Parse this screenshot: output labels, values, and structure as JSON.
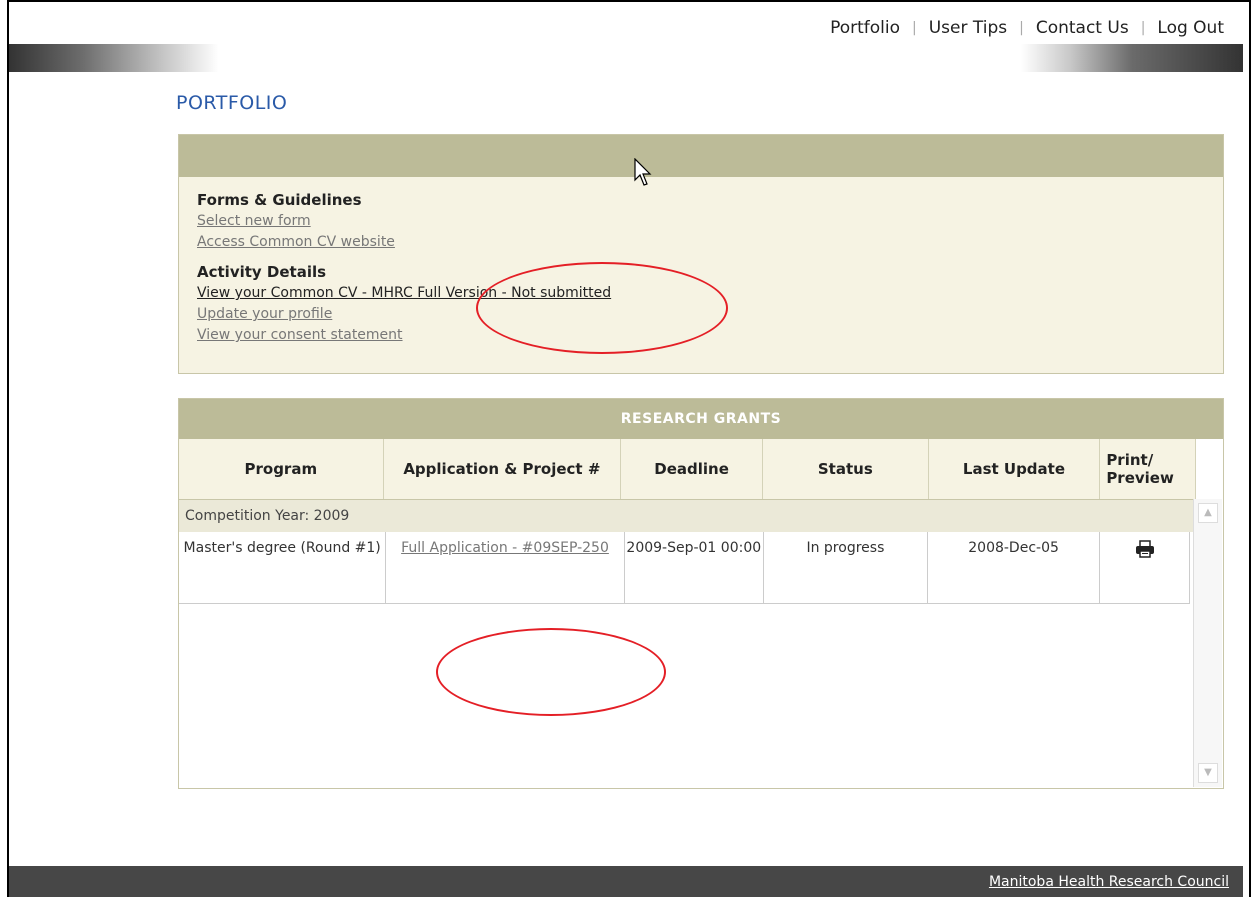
{
  "nav": {
    "items": [
      "Portfolio",
      "User Tips",
      "Contact Us",
      "Log Out"
    ],
    "separator": "|"
  },
  "page": {
    "title": "PORTFOLIO"
  },
  "forms": {
    "section_title": "Forms & Guidelines",
    "links": [
      "Select new form",
      "Access Common CV website"
    ]
  },
  "activity": {
    "section_title": "Activity Details",
    "links": [
      "View your Common CV - MHRC Full Version - Not submitted",
      "Update your profile",
      "View your consent statement"
    ]
  },
  "grants": {
    "title": "RESEARCH GRANTS",
    "columns": [
      "Program",
      "Application & Project #",
      "Deadline",
      "Status",
      "Last Update",
      "Print/ Preview"
    ],
    "competition_label": "Competition Year: 2009",
    "rows": [
      {
        "program": "Master's degree (Round #1)",
        "application": "Full Application - #09SEP-250",
        "deadline": "2009-Sep-01 00:00",
        "status": "In progress",
        "last_update": "2008-Dec-05",
        "print_icon": "printer-icon"
      }
    ]
  },
  "footer": {
    "link": "Manitoba Health Research Council"
  },
  "colors": {
    "accent": "#bcbb98",
    "panel": "#f6f3e3",
    "title": "#2a5aa8",
    "annotation": "#e41f26"
  }
}
